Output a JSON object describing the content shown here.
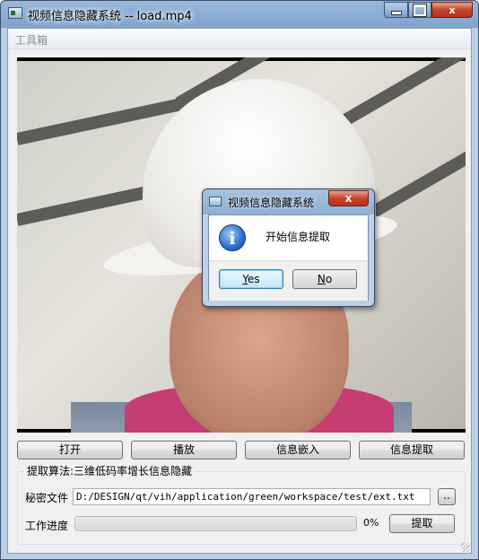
{
  "window": {
    "title": "视频信息隐藏系统 -- load.mp4"
  },
  "menu": {
    "items": [
      "工具箱"
    ]
  },
  "dialog": {
    "title": "视频信息隐藏系统",
    "message": "开始信息提取",
    "yes": {
      "accel": "Y",
      "rest": "es"
    },
    "no": {
      "accel": "N",
      "rest": "o"
    },
    "close_glyph": "x"
  },
  "buttons": {
    "open": "打开",
    "play": "播放",
    "embed": "信息嵌入",
    "extract": "信息提取"
  },
  "group": {
    "title": "提取算法:三维低码率增长信息隐藏",
    "secret_file_label": "秘密文件",
    "secret_file_path": "D:/DESIGN/qt/vih/application/green/workspace/test/ext.txt",
    "browse_label": "..",
    "progress_label": "工作进度",
    "progress_value": 0,
    "progress_text": "0%",
    "run_label": "提取"
  },
  "colors": {
    "progress": "#35c43f",
    "close_button": "#c7452a"
  },
  "icons": {
    "dialog": "information-icon"
  }
}
